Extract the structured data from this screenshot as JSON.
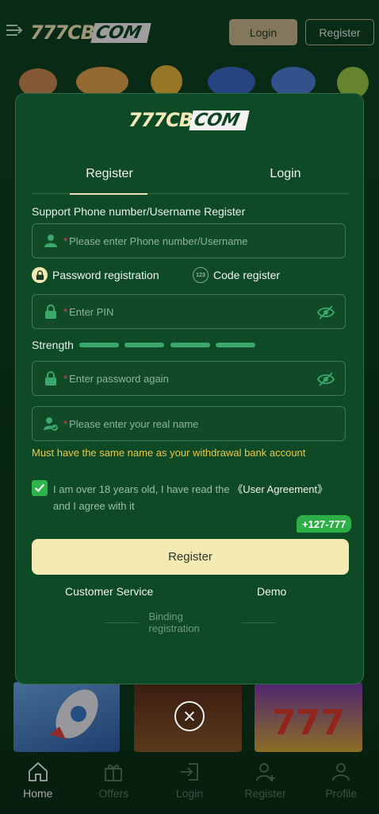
{
  "header": {
    "brand_main": "777CB",
    "brand_tag": "COM",
    "login_label": "Login",
    "register_label": "Register"
  },
  "modal": {
    "logo_main": "777CB",
    "logo_tag": "COM",
    "tabs": [
      {
        "label": "Register",
        "active": true
      },
      {
        "label": "Login",
        "active": false
      }
    ],
    "section_label": "Support Phone number/Username Register",
    "username_placeholder": "Please enter Phone number/Username",
    "options": {
      "password_registration": "Password registration",
      "code_register": "Code register",
      "code_icon_text": "123"
    },
    "pin_placeholder": "Enter PIN",
    "strength_label": "Strength",
    "confirm_placeholder": "Enter password again",
    "realname_placeholder": "Please enter your real name",
    "name_warning": "Must have the same name as your withdrawal bank account",
    "agreement_prefix": "I am over 18 years old, I have read the",
    "agreement_link": "《User Agreement》",
    "agreement_suffix": "and I agree with it",
    "agreement_checked": true,
    "phone_badge": "+127-777",
    "register_button": "Register",
    "customer_service": "Customer Service",
    "demo": "Demo",
    "binding_registration": "Binding registration",
    "required_mark": "*"
  },
  "bottom_nav": [
    {
      "label": "Home",
      "icon": "home-icon",
      "active": true
    },
    {
      "label": "Offers",
      "icon": "gift-icon",
      "active": false
    },
    {
      "label": "Login",
      "icon": "login-icon",
      "active": false
    },
    {
      "label": "Register",
      "icon": "add-user-icon",
      "active": false
    },
    {
      "label": "Profile",
      "icon": "profile-icon",
      "active": false
    }
  ],
  "colors": {
    "background": "#0d3a1e",
    "modal": "#0f4a27",
    "accent_gold": "#f3e9b3",
    "warning": "#e8c64a",
    "check_green": "#2fb34b"
  }
}
